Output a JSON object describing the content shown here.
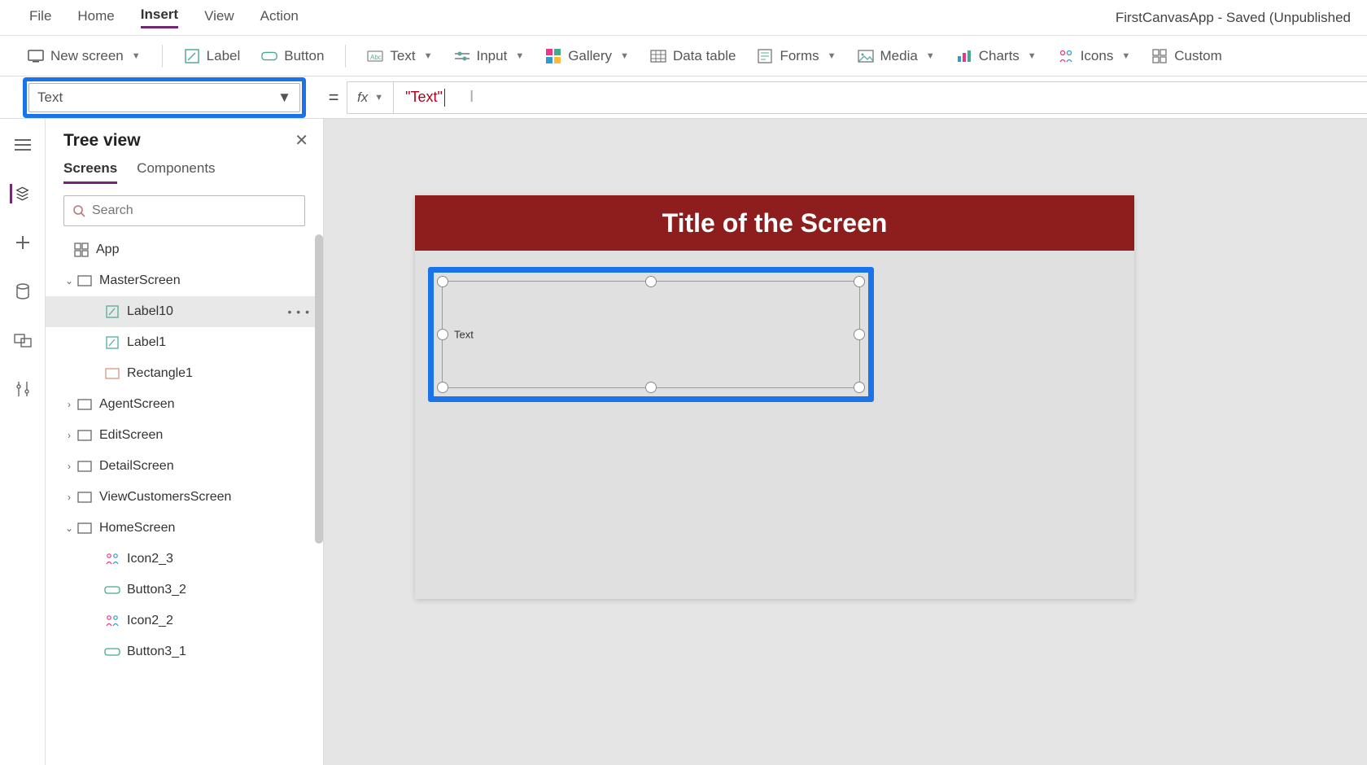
{
  "menubar": {
    "items": [
      "File",
      "Home",
      "Insert",
      "View",
      "Action"
    ],
    "active": "Insert",
    "appTitle": "FirstCanvasApp - Saved (Unpublished"
  },
  "ribbon": {
    "newScreen": "New screen",
    "label": "Label",
    "button": "Button",
    "text": "Text",
    "input": "Input",
    "gallery": "Gallery",
    "dataTable": "Data table",
    "forms": "Forms",
    "media": "Media",
    "charts": "Charts",
    "icons": "Icons",
    "custom": "Custom"
  },
  "formula": {
    "property": "Text",
    "equals": "=",
    "fx": "fx",
    "value": "\"Text\""
  },
  "tree": {
    "title": "Tree view",
    "tabs": {
      "screens": "Screens",
      "components": "Components",
      "active": "Screens"
    },
    "searchPlaceholder": "Search",
    "nodes": [
      {
        "kind": "app",
        "label": "App",
        "indent": 0
      },
      {
        "kind": "screen",
        "label": "MasterScreen",
        "indent": 1,
        "exp": "v"
      },
      {
        "kind": "label",
        "label": "Label10",
        "indent": 2,
        "selected": true,
        "more": true
      },
      {
        "kind": "label",
        "label": "Label1",
        "indent": 2
      },
      {
        "kind": "rect",
        "label": "Rectangle1",
        "indent": 2
      },
      {
        "kind": "screen",
        "label": "AgentScreen",
        "indent": 1,
        "exp": ">"
      },
      {
        "kind": "screen",
        "label": "EditScreen",
        "indent": 1,
        "exp": ">"
      },
      {
        "kind": "screen",
        "label": "DetailScreen",
        "indent": 1,
        "exp": ">"
      },
      {
        "kind": "screen",
        "label": "ViewCustomersScreen",
        "indent": 1,
        "exp": ">"
      },
      {
        "kind": "screen",
        "label": "HomeScreen",
        "indent": 1,
        "exp": "v"
      },
      {
        "kind": "icon",
        "label": "Icon2_3",
        "indent": 3
      },
      {
        "kind": "button",
        "label": "Button3_2",
        "indent": 3
      },
      {
        "kind": "icon",
        "label": "Icon2_2",
        "indent": 3
      },
      {
        "kind": "button",
        "label": "Button3_1",
        "indent": 3
      }
    ]
  },
  "canvas": {
    "title": "Title of the Screen",
    "labelText": "Text"
  },
  "colors": {
    "accent": "#1a73e8",
    "brand": "#742774",
    "titlebar": "#8e1e1e"
  }
}
